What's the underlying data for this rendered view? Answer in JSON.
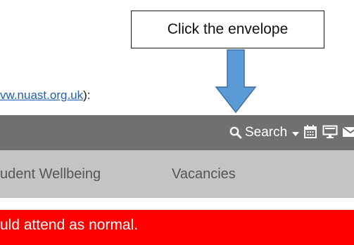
{
  "callout": {
    "text": "Click the envelope"
  },
  "intro": {
    "link_text": "vw.nuast.org.uk",
    "trailing_text": "):"
  },
  "topbar": {
    "search_label": "Search",
    "icons": [
      "calendar-icon",
      "monitor-icon",
      "envelope-icon",
      "desktop-icon",
      "twitter-icon"
    ]
  },
  "nav": {
    "items": [
      "udent Wellbeing",
      "Vacancies"
    ]
  },
  "alert": {
    "text": "uld attend as normal."
  },
  "colors": {
    "topbar_bg": "#707070",
    "nav_bg": "#c4c4c4",
    "alert_bg": "#ff0000",
    "arrow_fill": "#5b9bd5",
    "link": "#1f5fb0"
  }
}
